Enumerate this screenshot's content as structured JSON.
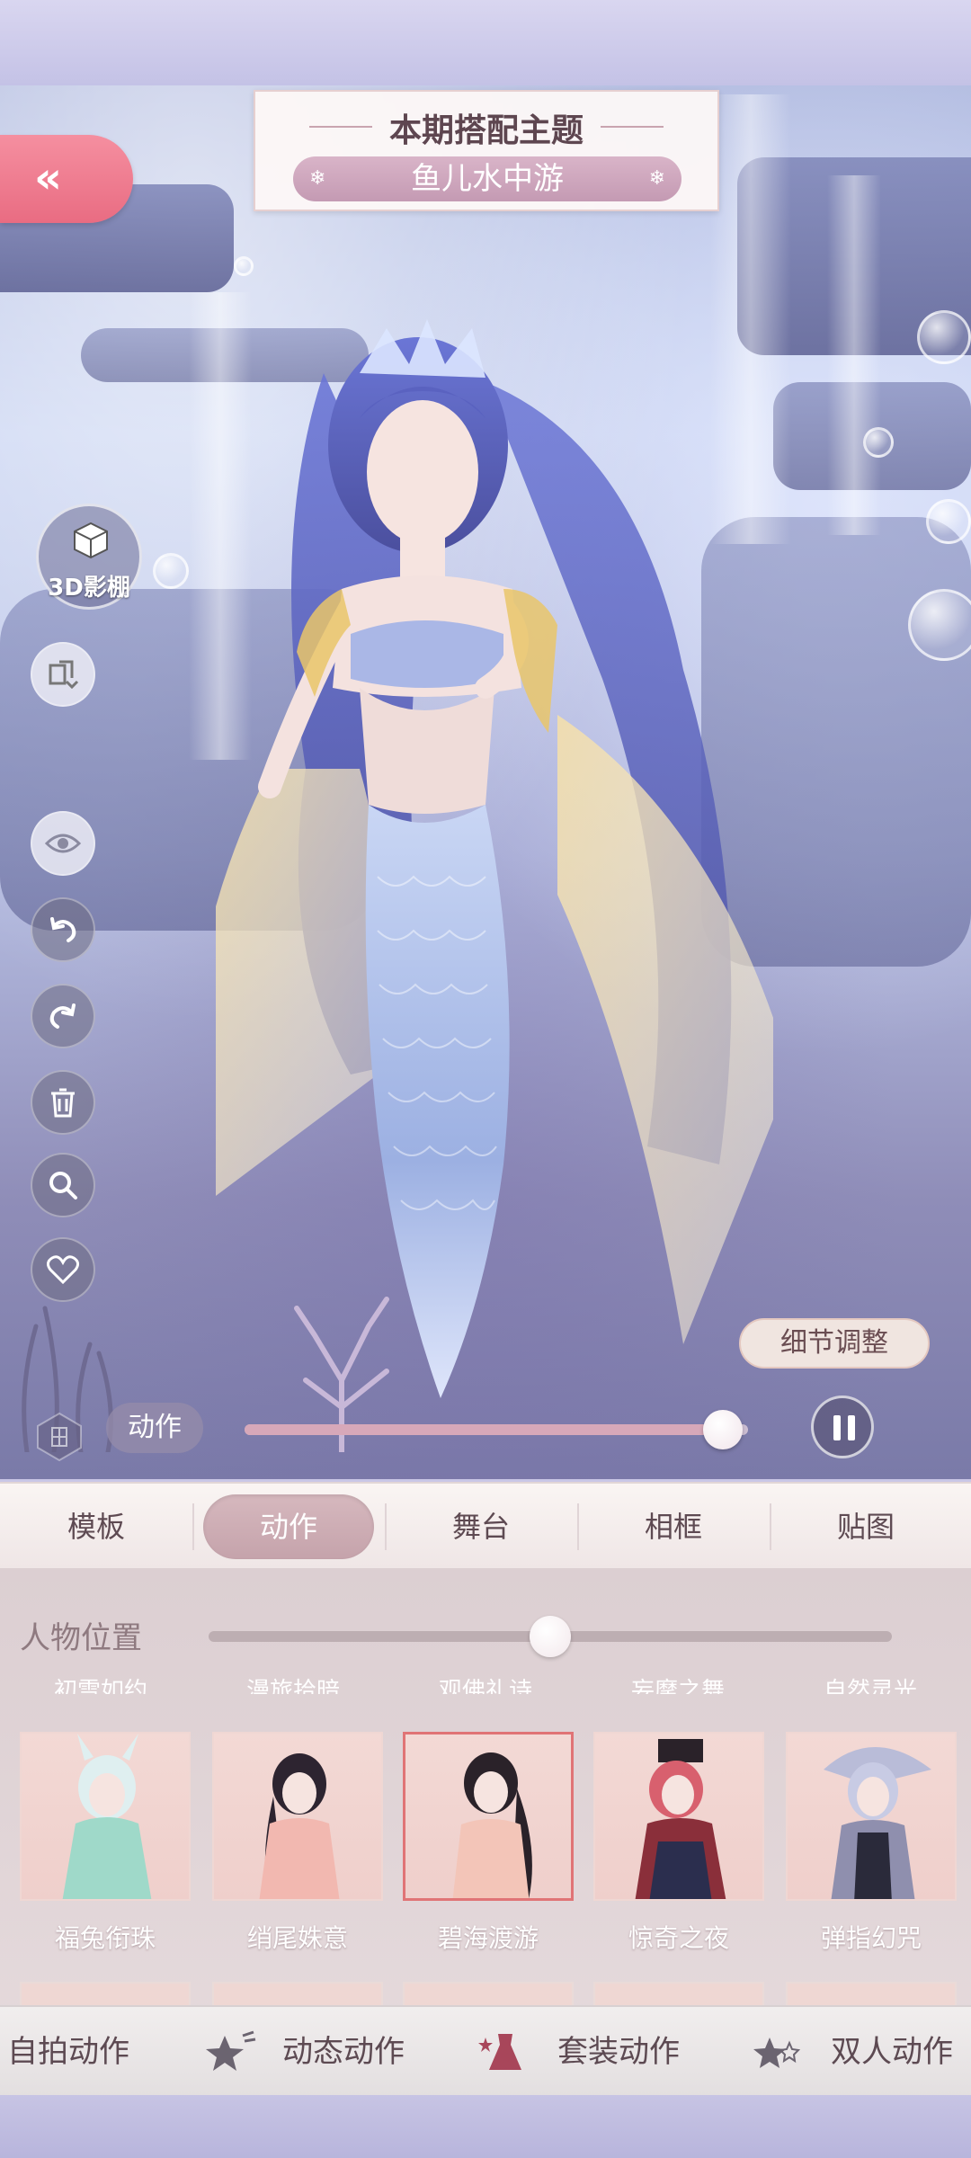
{
  "theme": {
    "title": "本期搭配主题",
    "name": "鱼儿水中游"
  },
  "back_button": {
    "icon": "double-chevron-left-icon"
  },
  "studio_button": {
    "label": "3D影棚",
    "icon": "cube-icon"
  },
  "side_tools": [
    {
      "id": "swap",
      "icon": "swap-pose-icon"
    },
    {
      "id": "visibility",
      "icon": "eye-icon"
    },
    {
      "id": "undo",
      "icon": "undo-icon"
    },
    {
      "id": "redo",
      "icon": "redo-icon"
    },
    {
      "id": "delete",
      "icon": "trash-icon"
    },
    {
      "id": "zoom",
      "icon": "search-icon"
    },
    {
      "id": "favorite",
      "icon": "heart-icon"
    }
  ],
  "detail_button": {
    "label": "细节调整"
  },
  "action_bar": {
    "label": "动作",
    "progress": 0.95,
    "pause_icon": "pause-icon"
  },
  "tabs": [
    {
      "label": "模板",
      "active": false
    },
    {
      "label": "动作",
      "active": true
    },
    {
      "label": "舞台",
      "active": false
    },
    {
      "label": "相框",
      "active": false
    },
    {
      "label": "贴图",
      "active": false
    }
  ],
  "position": {
    "label": "人物位置",
    "value": 0.5
  },
  "cut_labels": [
    "初雪如约",
    "漫旅拾暗",
    "观佛礼诗",
    "妄摩之舞",
    "自然灵光"
  ],
  "cards": [
    {
      "name": "福兔衔珠",
      "selected": false,
      "color": "#9fd9c9"
    },
    {
      "name": "绡尾姝意",
      "selected": false,
      "color": "#f2b8b0"
    },
    {
      "name": "碧海渡游",
      "selected": true,
      "color": "#f3c5b8"
    },
    {
      "name": "惊奇之夜",
      "selected": false,
      "color": "#8a2f3a"
    },
    {
      "name": "弹指幻咒",
      "selected": false,
      "color": "#8f8fae"
    }
  ],
  "bottom_nav": [
    {
      "label": "自拍动作",
      "icon": ""
    },
    {
      "label": "动态动作",
      "icon": "star-icon"
    },
    {
      "label": "套装动作",
      "icon": "dress-star-icon"
    },
    {
      "label": "双人动作",
      "icon": "double-star-icon"
    }
  ],
  "colors": {
    "accent_pink": "#e96c82",
    "theme_pill": "#c49ab3",
    "selected_border": "#e07476"
  }
}
